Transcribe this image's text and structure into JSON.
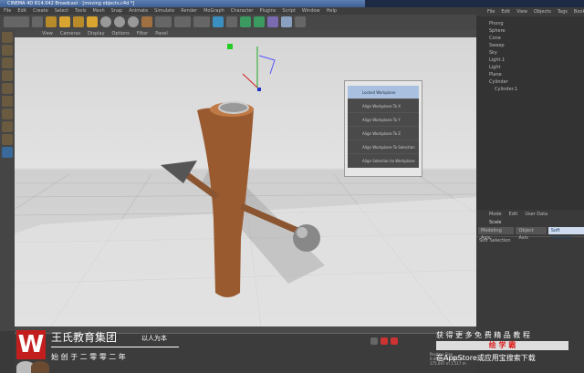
{
  "title": "CINEMA 4D R14.042 Broadcast - [moving objects.c4d *]",
  "menu": [
    "File",
    "Edit",
    "Create",
    "Select",
    "Tools",
    "Mesh",
    "Snap",
    "Animate",
    "Simulate",
    "Render",
    "MoGraph",
    "Character",
    "Plugins",
    "Script",
    "Window",
    "Help"
  ],
  "viewport_menu": [
    "View",
    "Cameras",
    "Display",
    "Options",
    "Filter",
    "Panel"
  ],
  "object_manager": {
    "menu": [
      "File",
      "Edit",
      "View",
      "Objects",
      "Tags",
      "Bookmarks"
    ],
    "objects": [
      "Phong",
      "Sphere",
      "Cone",
      "Sweep",
      "Sky",
      "Light.1",
      "Light",
      "Plane",
      "Cylinder",
      "Cylinder.1"
    ]
  },
  "popup": {
    "items": [
      "Locked Workplane",
      "Align Workplane To X",
      "Align Workplane To Y",
      "Align Workplane To Z",
      "Align Workplane To Selection",
      "Align Selection to Workplane"
    ]
  },
  "attributes": {
    "menu": [
      "Mode",
      "Edit",
      "User Data"
    ],
    "object": "Scale",
    "tabs": [
      "Modeling Axis",
      "Object Axis",
      "Soft Selection"
    ],
    "section": "Soft Selection"
  },
  "coords": {
    "headers": [
      "Position",
      "Size"
    ],
    "values": [
      "0.408 m",
      "40.183 m",
      "175.047 m",
      "1.517 m"
    ]
  },
  "watermark": {
    "logo": "W",
    "brand": "王氏教育集团",
    "slogan": "以人为本",
    "since": "始 创 于 二 零 零 二 年",
    "right1": "获 得 更 多 免 费 精 品 教 程",
    "right2": "绘 学 霸",
    "right3": "在AppStore或应用宝搜索下载"
  }
}
